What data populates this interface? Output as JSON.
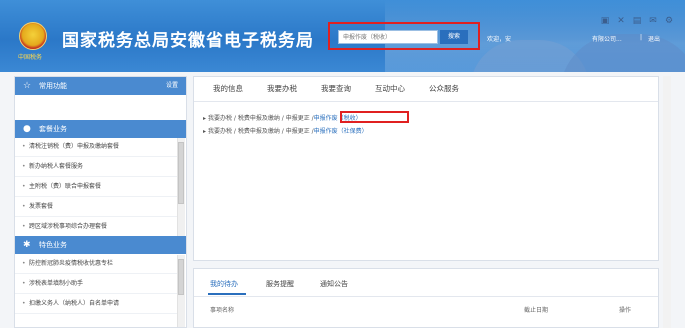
{
  "header": {
    "title": "国家税务总局安徽省电子税务局",
    "emblem_caption": "中国税务",
    "search": {
      "placeholder": "申报作废（税收）",
      "value": "申报作废（税收）",
      "button_label": "搜索"
    },
    "welcome": "欢迎，安",
    "company": "有限公司...",
    "separator": "|",
    "logout_label": "退出",
    "toolbar_icons": [
      "grid-icon",
      "shrink-icon",
      "calendar-icon",
      "mail-icon",
      "settings-icon"
    ],
    "colors": {
      "bar": "#2b78c8",
      "title": "#ffffff",
      "highlight": "#e02020"
    }
  },
  "sidebar": {
    "common": {
      "label": "常用功能",
      "settings_label": "设置"
    },
    "biz_section": {
      "label": "套餐业务",
      "items": [
        "清税注销税（费）申报及缴纳套餐",
        "新办纳税人套餐服务",
        "主附税（费）联合申报套餐",
        "发票套餐",
        "跨区域涉税事项综合办理套餐"
      ]
    },
    "special_section": {
      "label": "特色业务",
      "items": [
        "防控新冠肺炎疫情税收优惠专栏",
        "涉税表单填制小助手",
        "扣缴义务人（纳税人）自名单申请"
      ]
    }
  },
  "main": {
    "tabs": [
      "我的信息",
      "我要办税",
      "我要查询",
      "互动中心",
      "公众服务"
    ],
    "breadcrumbs": [
      {
        "path": "我要办税 / 税费申报及缴纳 / 申报更正 /",
        "target": "申报作废（税收）"
      },
      {
        "path": "我要办税 / 税费申报及缴纳 / 申报更正 /",
        "target": "申报作废（社保费）"
      }
    ]
  },
  "bottom": {
    "tabs": [
      "我的待办",
      "服务提醒",
      "通知公告"
    ],
    "active_tab": "我的待办",
    "columns": [
      "事项名称",
      "截止日期",
      "操作"
    ]
  }
}
